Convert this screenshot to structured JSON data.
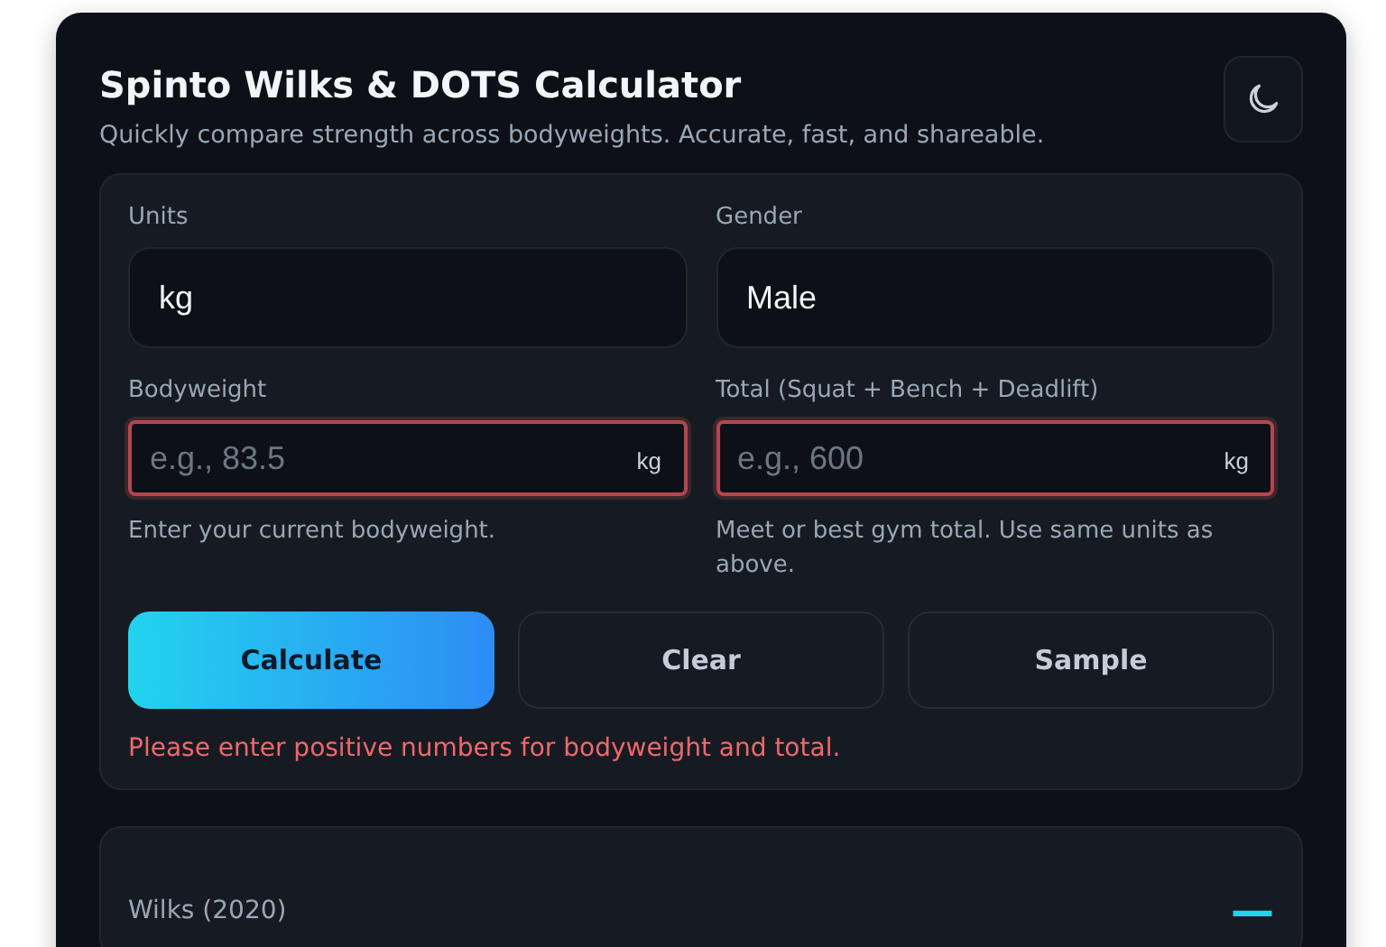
{
  "header": {
    "title": "Spinto Wilks & DOTS Calculator",
    "subtitle": "Quickly compare strength across bodyweights. Accurate, fast, and shareable."
  },
  "selects": [
    {
      "label": "Units",
      "value": "kg"
    },
    {
      "label": "Gender",
      "value": "Male"
    }
  ],
  "inputs": [
    {
      "label": "Bodyweight",
      "placeholder": "e.g., 83.5",
      "unit": "kg",
      "invalid": true,
      "help": "Enter your current bodyweight."
    },
    {
      "label": "Total (Squat + Bench + Deadlift)",
      "placeholder": "e.g., 600",
      "unit": "kg",
      "invalid": true,
      "help": "Meet or best gym total. Use same units as above."
    }
  ],
  "buttons": [
    {
      "label": "Calculate",
      "kind": "primary"
    },
    {
      "label": "Clear",
      "kind": "secondary"
    },
    {
      "label": "Sample",
      "kind": "secondary"
    }
  ],
  "error": "Please enter positive numbers for bodyweight and total.",
  "results": [
    {
      "label": "Wilks (2020)",
      "value": "—"
    }
  ]
}
